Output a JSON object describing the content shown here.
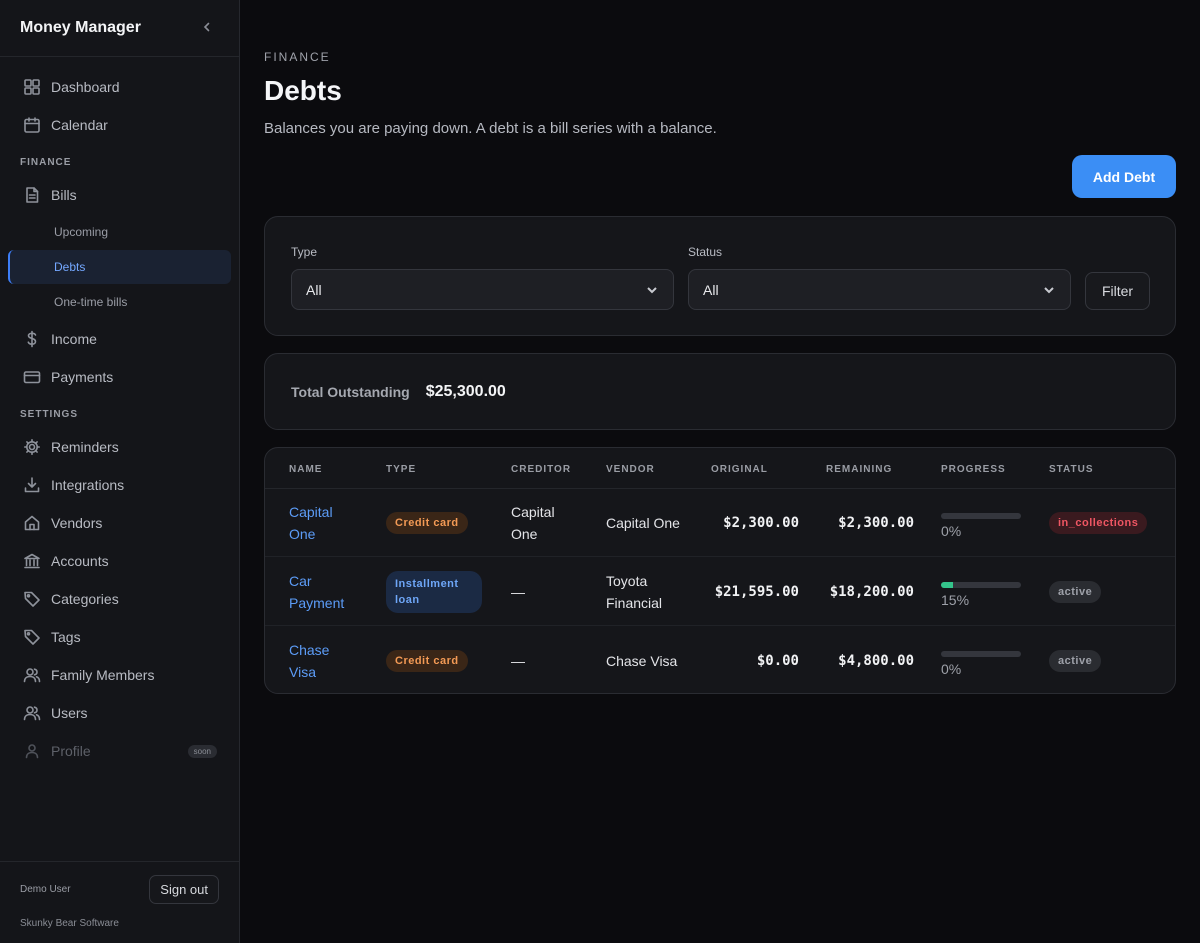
{
  "app": {
    "title": "Money Manager"
  },
  "sidebar": {
    "top_items": [
      {
        "label": "Dashboard",
        "icon": "grid-icon"
      },
      {
        "label": "Calendar",
        "icon": "calendar-icon"
      }
    ],
    "finance_label": "FINANCE",
    "bills_label": "Bills",
    "bills_sub": [
      "Upcoming",
      "Debts",
      "One-time bills"
    ],
    "income_label": "Income",
    "payments_label": "Payments",
    "settings_label": "SETTINGS",
    "settings_items": [
      "Reminders",
      "Integrations",
      "Vendors",
      "Accounts",
      "Categories",
      "Tags",
      "Family Members",
      "Users"
    ],
    "profile_label": "Profile",
    "soon_label": "soon",
    "user": "Demo User",
    "signout": "Sign out",
    "company": "Skunky Bear Software"
  },
  "page": {
    "eyebrow": "FINANCE",
    "title": "Debts",
    "description": "Balances you are paying down. A debt is a bill series with a balance.",
    "add_button": "Add Debt"
  },
  "filters": {
    "type_label": "Type",
    "type_value": "All",
    "status_label": "Status",
    "status_value": "All",
    "filter_button": "Filter"
  },
  "summary": {
    "label": "Total Outstanding",
    "value": "$25,300.00"
  },
  "table": {
    "headers": [
      "NAME",
      "TYPE",
      "CREDITOR",
      "VENDOR",
      "ORIGINAL",
      "REMAINING",
      "PROGRESS",
      "STATUS"
    ],
    "rows": [
      {
        "name": "Capital One",
        "type": "Credit card",
        "creditor": "Capital One",
        "vendor": "Capital One",
        "original": "$2,300.00",
        "remaining": "$2,300.00",
        "progress": 0,
        "progress_label": "0%",
        "status": "in_collections"
      },
      {
        "name": "Car Payment",
        "type": "Installment loan",
        "creditor": "—",
        "vendor": "Toyota Financial",
        "original": "$21,595.00",
        "remaining": "$18,200.00",
        "progress": 15,
        "progress_label": "15%",
        "status": "active"
      },
      {
        "name": "Chase Visa",
        "type": "Credit card",
        "creditor": "—",
        "vendor": "Chase Visa",
        "original": "$0.00",
        "remaining": "$4,800.00",
        "progress": 0,
        "progress_label": "0%",
        "status": "active"
      }
    ]
  },
  "colors": {
    "accent": "#3b8ef5",
    "link": "#5c9cf7",
    "progress": "#34c48b",
    "danger": "#ef5663"
  }
}
